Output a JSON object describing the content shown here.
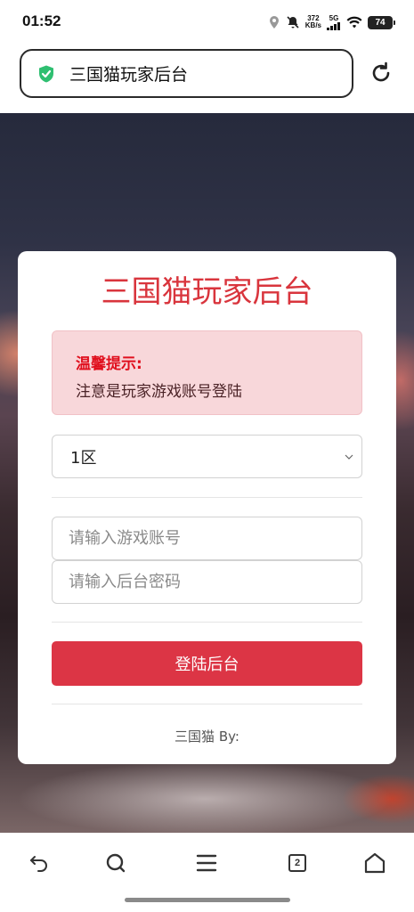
{
  "status_bar": {
    "time": "01:52",
    "net_speed_value": "372",
    "net_speed_unit": "KB/s",
    "network_type": "5G",
    "battery_level": "74"
  },
  "browser": {
    "address_text": "三国猫玩家后台",
    "tab_count": "2",
    "icons": [
      "shield-check-icon",
      "reload-icon",
      "back-icon",
      "search-icon",
      "menu-icon",
      "tabs-icon",
      "home-icon"
    ]
  },
  "page": {
    "title": "三国猫玩家后台",
    "notice": {
      "title": "温馨提示:",
      "text": "注意是玩家游戏账号登陆"
    },
    "server_select": {
      "selected": "1区"
    },
    "account_input": {
      "placeholder": "请输入游戏账号",
      "value": ""
    },
    "password_input": {
      "placeholder": "请输入后台密码",
      "value": ""
    },
    "login_button": "登陆后台",
    "footer": "三国猫 By:"
  },
  "colors": {
    "accent": "#dc3545",
    "title_red": "#d9353d",
    "notice_bg": "#f8d7da",
    "notice_title": "#e0101e",
    "shield_green": "#2fbf71"
  }
}
